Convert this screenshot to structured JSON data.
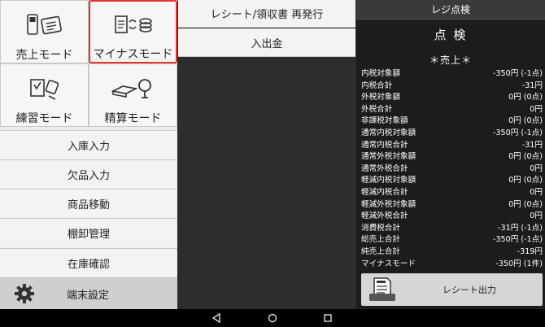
{
  "left": {
    "tiles": [
      {
        "label": "売上モード",
        "icon": "register-sales-icon"
      },
      {
        "label": "マイナスモード",
        "icon": "minus-mode-icon"
      },
      {
        "label": "練習モード",
        "icon": "practice-mode-icon"
      },
      {
        "label": "精算モード",
        "icon": "settlement-mode-icon"
      }
    ],
    "rows": [
      "入庫入力",
      "欠品入力",
      "商品移動",
      "棚卸管理",
      "在庫確認"
    ],
    "settings_label": "端末設定",
    "accent": "#e0342f"
  },
  "middle": {
    "buttons": [
      "レシート/領収書 再発行",
      "入出金"
    ]
  },
  "right": {
    "header": "レジ点検",
    "title": "点 検",
    "section": "＊売上＊",
    "items": [
      {
        "label": "内税対象額",
        "value": "-350円 (-1点)"
      },
      {
        "label": "内税合計",
        "value": "-31円"
      },
      {
        "label": "外税対象額",
        "value": "0円 (0点)"
      },
      {
        "label": "外税合計",
        "value": "0円"
      },
      {
        "label": "非課税対象額",
        "value": "0円 (0点)"
      },
      {
        "label": "通常内税対象額",
        "value": "-350円 (-1点)"
      },
      {
        "label": "通常内税合計",
        "value": "-31円"
      },
      {
        "label": "通常外税対象額",
        "value": "0円 (0点)"
      },
      {
        "label": "通常外税合計",
        "value": "0円"
      },
      {
        "label": "軽減内税対象額",
        "value": "0円 (0点)"
      },
      {
        "label": "軽減内税合計",
        "value": "0円"
      },
      {
        "label": "軽減外税対象額",
        "value": "0円 (0点)"
      },
      {
        "label": "軽減外税合計",
        "value": "0円"
      },
      {
        "label": "消費税合計",
        "value": "-31円 (-1点)"
      },
      {
        "label": "総売上合計",
        "value": "-350円 (-1点)"
      },
      {
        "label": "純売上合計",
        "value": "-319円"
      },
      {
        "label": "マイナスモード",
        "value": "-350円 (1件)"
      }
    ],
    "receipt_button": "レシート出力"
  },
  "nav": {
    "icons": [
      "back-icon",
      "home-icon",
      "recents-icon"
    ]
  }
}
